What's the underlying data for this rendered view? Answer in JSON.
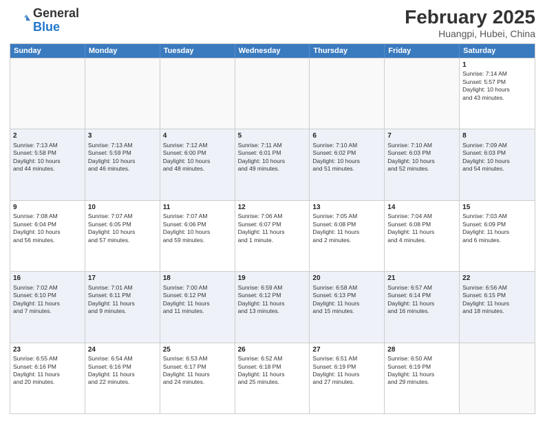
{
  "header": {
    "logo_general": "General",
    "logo_blue": "Blue",
    "month_title": "February 2025",
    "subtitle": "Huangpi, Hubei, China"
  },
  "days_of_week": [
    "Sunday",
    "Monday",
    "Tuesday",
    "Wednesday",
    "Thursday",
    "Friday",
    "Saturday"
  ],
  "weeks": [
    [
      {
        "day": "",
        "info": ""
      },
      {
        "day": "",
        "info": ""
      },
      {
        "day": "",
        "info": ""
      },
      {
        "day": "",
        "info": ""
      },
      {
        "day": "",
        "info": ""
      },
      {
        "day": "",
        "info": ""
      },
      {
        "day": "1",
        "info": "Sunrise: 7:14 AM\nSunset: 5:57 PM\nDaylight: 10 hours\nand 43 minutes."
      }
    ],
    [
      {
        "day": "2",
        "info": "Sunrise: 7:13 AM\nSunset: 5:58 PM\nDaylight: 10 hours\nand 44 minutes."
      },
      {
        "day": "3",
        "info": "Sunrise: 7:13 AM\nSunset: 5:59 PM\nDaylight: 10 hours\nand 46 minutes."
      },
      {
        "day": "4",
        "info": "Sunrise: 7:12 AM\nSunset: 6:00 PM\nDaylight: 10 hours\nand 48 minutes."
      },
      {
        "day": "5",
        "info": "Sunrise: 7:11 AM\nSunset: 6:01 PM\nDaylight: 10 hours\nand 49 minutes."
      },
      {
        "day": "6",
        "info": "Sunrise: 7:10 AM\nSunset: 6:02 PM\nDaylight: 10 hours\nand 51 minutes."
      },
      {
        "day": "7",
        "info": "Sunrise: 7:10 AM\nSunset: 6:03 PM\nDaylight: 10 hours\nand 52 minutes."
      },
      {
        "day": "8",
        "info": "Sunrise: 7:09 AM\nSunset: 6:03 PM\nDaylight: 10 hours\nand 54 minutes."
      }
    ],
    [
      {
        "day": "9",
        "info": "Sunrise: 7:08 AM\nSunset: 6:04 PM\nDaylight: 10 hours\nand 56 minutes."
      },
      {
        "day": "10",
        "info": "Sunrise: 7:07 AM\nSunset: 6:05 PM\nDaylight: 10 hours\nand 57 minutes."
      },
      {
        "day": "11",
        "info": "Sunrise: 7:07 AM\nSunset: 6:06 PM\nDaylight: 10 hours\nand 59 minutes."
      },
      {
        "day": "12",
        "info": "Sunrise: 7:06 AM\nSunset: 6:07 PM\nDaylight: 11 hours\nand 1 minute."
      },
      {
        "day": "13",
        "info": "Sunrise: 7:05 AM\nSunset: 6:08 PM\nDaylight: 11 hours\nand 2 minutes."
      },
      {
        "day": "14",
        "info": "Sunrise: 7:04 AM\nSunset: 6:08 PM\nDaylight: 11 hours\nand 4 minutes."
      },
      {
        "day": "15",
        "info": "Sunrise: 7:03 AM\nSunset: 6:09 PM\nDaylight: 11 hours\nand 6 minutes."
      }
    ],
    [
      {
        "day": "16",
        "info": "Sunrise: 7:02 AM\nSunset: 6:10 PM\nDaylight: 11 hours\nand 7 minutes."
      },
      {
        "day": "17",
        "info": "Sunrise: 7:01 AM\nSunset: 6:11 PM\nDaylight: 11 hours\nand 9 minutes."
      },
      {
        "day": "18",
        "info": "Sunrise: 7:00 AM\nSunset: 6:12 PM\nDaylight: 11 hours\nand 11 minutes."
      },
      {
        "day": "19",
        "info": "Sunrise: 6:59 AM\nSunset: 6:12 PM\nDaylight: 11 hours\nand 13 minutes."
      },
      {
        "day": "20",
        "info": "Sunrise: 6:58 AM\nSunset: 6:13 PM\nDaylight: 11 hours\nand 15 minutes."
      },
      {
        "day": "21",
        "info": "Sunrise: 6:57 AM\nSunset: 6:14 PM\nDaylight: 11 hours\nand 16 minutes."
      },
      {
        "day": "22",
        "info": "Sunrise: 6:56 AM\nSunset: 6:15 PM\nDaylight: 11 hours\nand 18 minutes."
      }
    ],
    [
      {
        "day": "23",
        "info": "Sunrise: 6:55 AM\nSunset: 6:16 PM\nDaylight: 11 hours\nand 20 minutes."
      },
      {
        "day": "24",
        "info": "Sunrise: 6:54 AM\nSunset: 6:16 PM\nDaylight: 11 hours\nand 22 minutes."
      },
      {
        "day": "25",
        "info": "Sunrise: 6:53 AM\nSunset: 6:17 PM\nDaylight: 11 hours\nand 24 minutes."
      },
      {
        "day": "26",
        "info": "Sunrise: 6:52 AM\nSunset: 6:18 PM\nDaylight: 11 hours\nand 25 minutes."
      },
      {
        "day": "27",
        "info": "Sunrise: 6:51 AM\nSunset: 6:19 PM\nDaylight: 11 hours\nand 27 minutes."
      },
      {
        "day": "28",
        "info": "Sunrise: 6:50 AM\nSunset: 6:19 PM\nDaylight: 11 hours\nand 29 minutes."
      },
      {
        "day": "",
        "info": ""
      }
    ]
  ]
}
